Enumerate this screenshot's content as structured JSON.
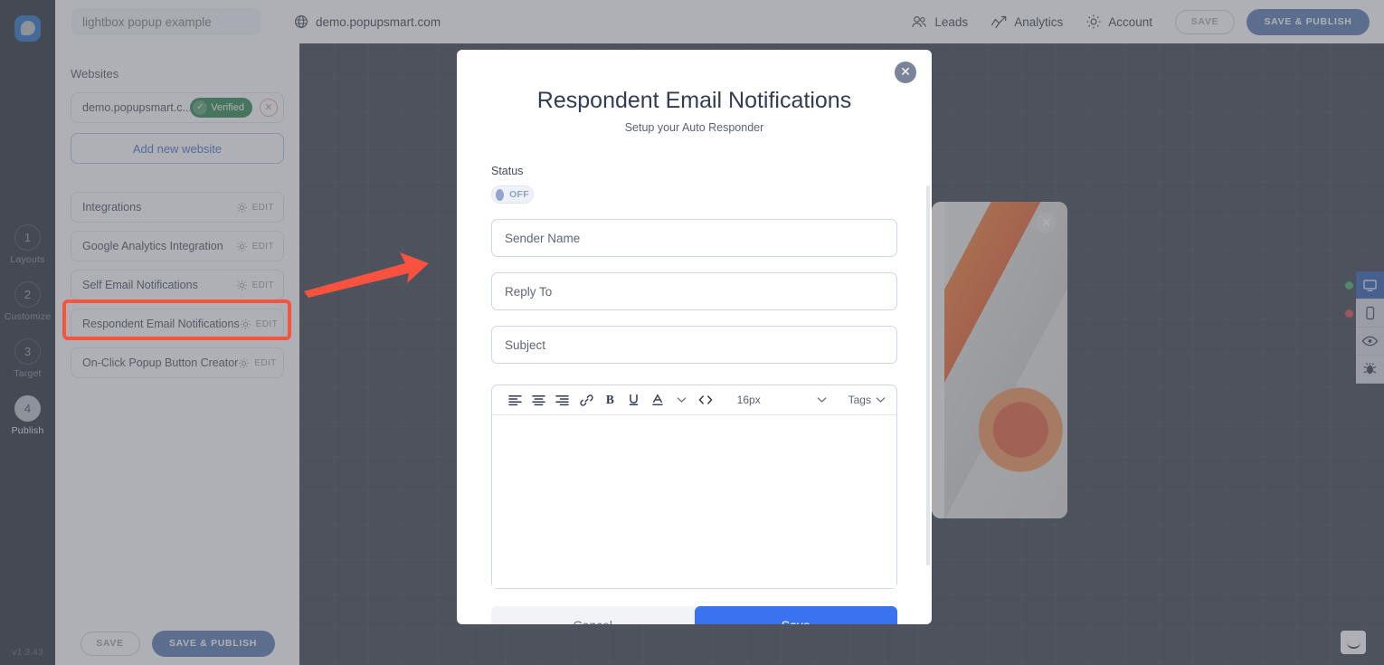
{
  "topbar": {
    "campaign_name_placeholder": "lightbox popup example",
    "campaign_name_value": "",
    "domain": "demo.popupsmart.com",
    "globe_icon": "globe-icon",
    "links": [
      {
        "label": "Leads",
        "icon": "leads-icon"
      },
      {
        "label": "Analytics",
        "icon": "analytics-icon"
      },
      {
        "label": "Account",
        "icon": "gear-icon"
      }
    ],
    "save_label": "SAVE",
    "save_publish_label": "SAVE & PUBLISH"
  },
  "rail": {
    "logo_icon": "popupsmart-logo-icon",
    "steps": [
      {
        "number": "1",
        "label": "Layouts",
        "active": false
      },
      {
        "number": "2",
        "label": "Customize",
        "active": false
      },
      {
        "number": "3",
        "label": "Target",
        "active": false
      },
      {
        "number": "4",
        "label": "Publish",
        "active": true
      }
    ],
    "version": "v1.3.43"
  },
  "panel": {
    "websites_title": "Websites",
    "website": {
      "url": "demo.popupsmart.c...",
      "status_label": "Verified",
      "check_icon": "check-circle-icon",
      "delete_icon": "close-circle-icon"
    },
    "add_website_label": "Add new website",
    "edit_label": "EDIT",
    "gear_icon": "gear-icon",
    "integrations": [
      {
        "name": "Integrations",
        "highlighted": false
      },
      {
        "name": "Google Analytics Integration",
        "highlighted": false
      },
      {
        "name": "Self Email Notifications",
        "highlighted": false
      },
      {
        "name": "Respondent Email Notifications",
        "highlighted": true
      },
      {
        "name": "On-Click Popup Button Creator",
        "highlighted": false
      }
    ],
    "footer_save_label": "SAVE",
    "footer_publish_label": "SAVE & PUBLISH"
  },
  "canvas": {
    "popup_preview_close_icon": "close-icon",
    "annotation_arrow_icon": "red-arrow-annotation-icon"
  },
  "tool_rail": {
    "items": [
      {
        "icon": "desktop-icon",
        "active": true,
        "dot": "green"
      },
      {
        "icon": "mobile-icon",
        "active": false,
        "dot": "red"
      },
      {
        "icon": "eye-icon",
        "active": false,
        "dot": ""
      },
      {
        "icon": "bug-icon",
        "active": false,
        "dot": ""
      }
    ],
    "chat_widget_icon": "chat-smiley-icon"
  },
  "modal": {
    "close_icon": "close-icon",
    "title": "Respondent Email Notifications",
    "subtitle": "Setup your Auto Responder",
    "status_label": "Status",
    "toggle_state": "OFF",
    "fields": [
      {
        "placeholder": "Sender Name",
        "value": ""
      },
      {
        "placeholder": "Reply To",
        "value": ""
      },
      {
        "placeholder": "Subject",
        "value": ""
      }
    ],
    "editor": {
      "tools": [
        {
          "icon": "align-left-icon"
        },
        {
          "icon": "align-center-icon"
        },
        {
          "icon": "align-right-icon"
        },
        {
          "icon": "link-icon"
        },
        {
          "icon": "bold-icon"
        },
        {
          "icon": "underline-icon"
        },
        {
          "icon": "font-color-icon"
        },
        {
          "icon": "chevron-down-icon"
        },
        {
          "icon": "code-icon"
        }
      ],
      "font_size": "16px",
      "font_size_caret_icon": "chevron-down-icon",
      "tags_label": "Tags",
      "tags_caret_icon": "chevron-down-icon",
      "body_value": ""
    },
    "cancel_label": "Cancel",
    "save_label": "Save"
  }
}
